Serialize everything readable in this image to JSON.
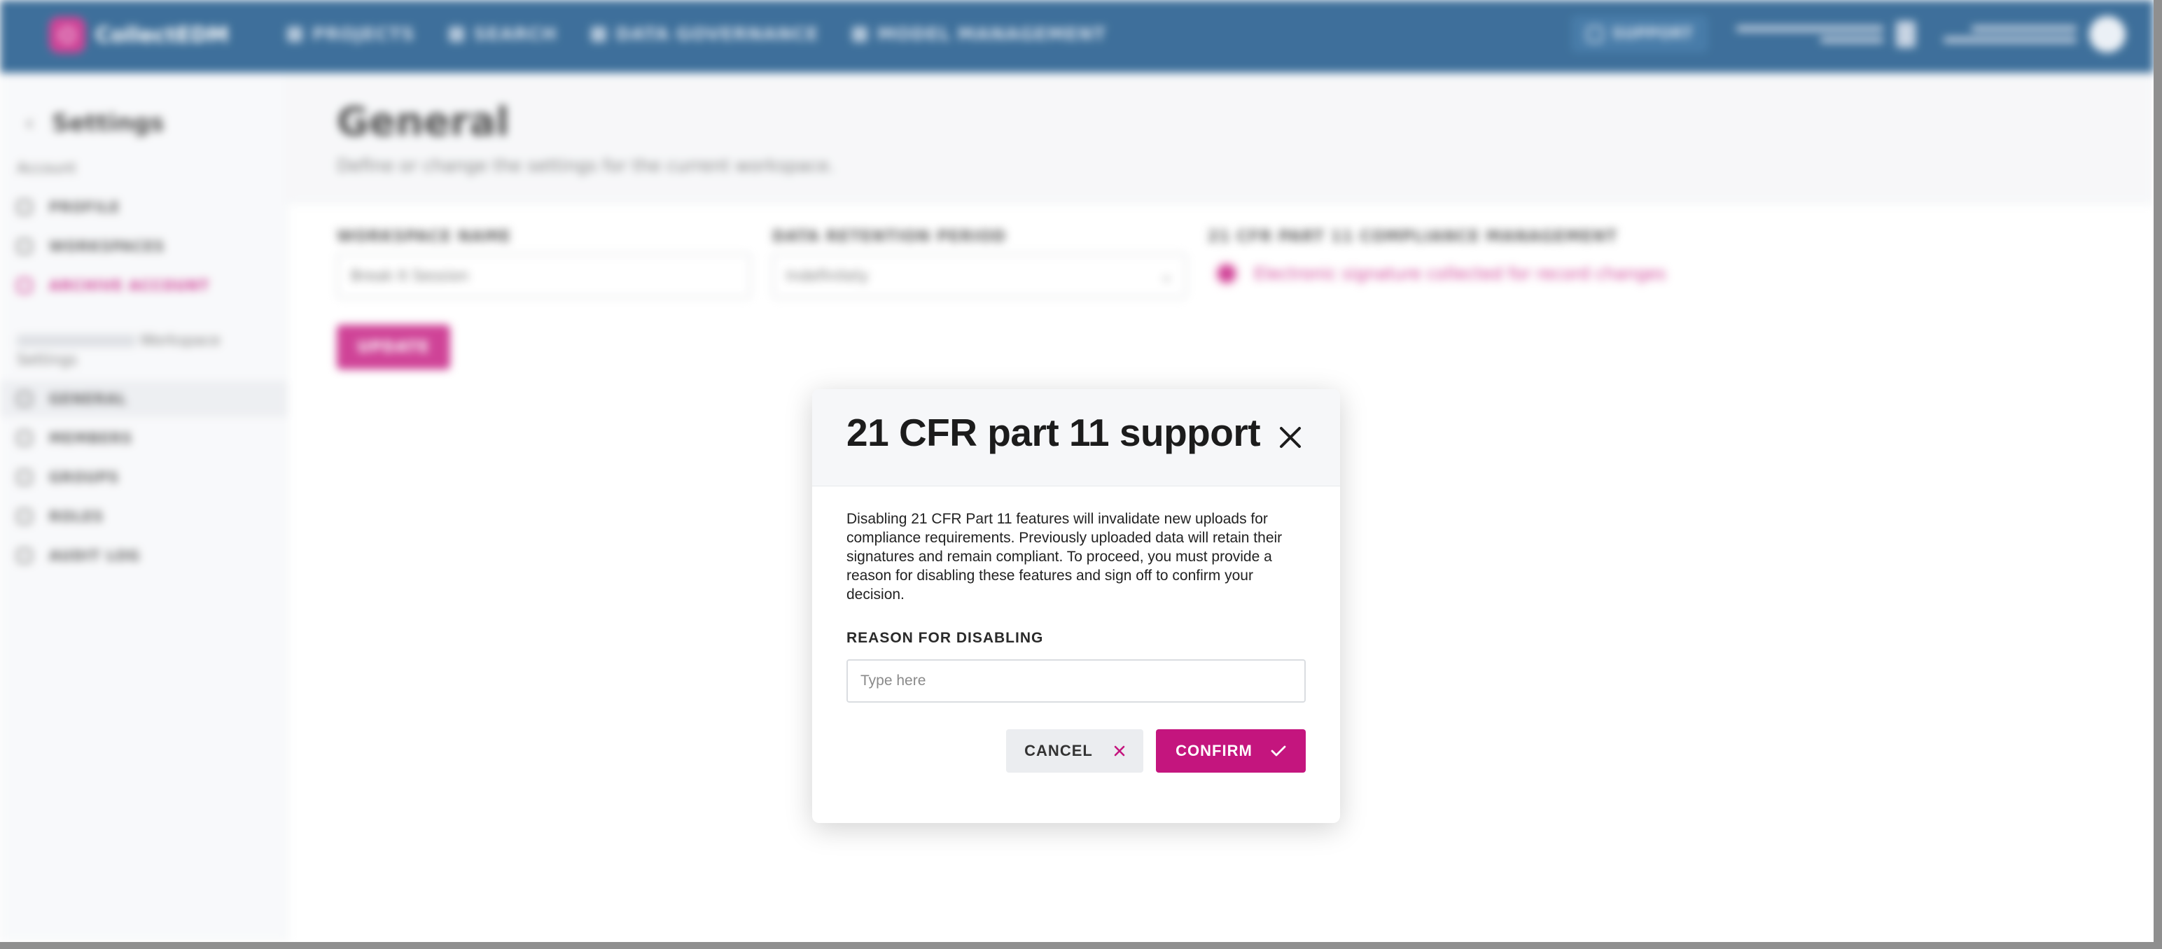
{
  "app": {
    "logo_text": "CollectEDM",
    "nav": [
      "PROJECTS",
      "SEARCH",
      "DATA GOVERNANCE",
      "MODEL MANAGEMENT"
    ],
    "support_label": "SUPPORT"
  },
  "sidebar": {
    "title": "Settings",
    "account_section": "Account",
    "account_items": [
      "PROFILE",
      "WORKSPACES",
      "ARCHIVE ACCOUNT"
    ],
    "workspace_section_suffix": "Workspace",
    "workspace_section_line2": "Settings",
    "workspace_items": [
      "GENERAL",
      "MEMBERS",
      "GROUPS",
      "ROLES",
      "AUDIT LOG"
    ]
  },
  "main": {
    "title": "General",
    "subtitle": "Define or change the settings for the current workspace.",
    "workspace_name_label": "WORKSPACE NAME",
    "workspace_name_value": "Break It Session",
    "retention_label": "DATA RETENTION PERIOD",
    "retention_value": "Indefinitely",
    "compliance_label": "21 CFR PART 11 COMPLIANCE MANAGEMENT",
    "compliance_option": "Electronic signature collected for record changes",
    "update_label": "UPDATE"
  },
  "modal": {
    "title": "21 CFR part 11 support",
    "body": "Disabling 21 CFR Part 11 features will invalidate new uploads for compliance requirements. Previously uploaded data will retain their signatures and remain compliant. To proceed, you must provide a reason for disabling these features and sign off to confirm your decision.",
    "reason_label": "REASON FOR DISABLING",
    "reason_placeholder": "Type here",
    "reason_value": "",
    "cancel_label": "CANCEL",
    "confirm_label": "CONFIRM"
  },
  "colors": {
    "accent": "#c4157e",
    "topbar": "#0e4c82"
  },
  "icons": {
    "close": "close-icon",
    "cancel": "x-icon",
    "confirm": "checkmark-icon"
  }
}
